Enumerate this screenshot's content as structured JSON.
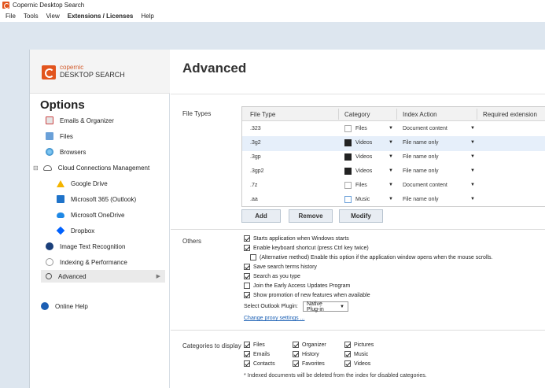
{
  "window": {
    "title": "Copernic Desktop Search"
  },
  "menu": [
    "File",
    "Tools",
    "View",
    "Extensions / Licenses",
    "Help"
  ],
  "logo": {
    "line1": "copernic",
    "line2": "DESKTOP SEARCH"
  },
  "sidebar": {
    "title": "Options",
    "items": [
      {
        "label": "Emails & Organizer",
        "icon": "mail-icon"
      },
      {
        "label": "Files",
        "icon": "files-icon"
      },
      {
        "label": "Browsers",
        "icon": "browser-icon"
      },
      {
        "label": "Cloud Connections Management",
        "icon": "cloud-icon"
      },
      {
        "label": "Google Drive",
        "icon": "google-drive-icon"
      },
      {
        "label": "Microsoft 365 (Outlook)",
        "icon": "microsoft-365-icon"
      },
      {
        "label": "Microsoft OneDrive",
        "icon": "onedrive-icon"
      },
      {
        "label": "Dropbox",
        "icon": "dropbox-icon"
      },
      {
        "label": "Image Text Recognition",
        "icon": "image-text-icon"
      },
      {
        "label": "Indexing & Performance",
        "icon": "indexing-icon"
      },
      {
        "label": "Advanced",
        "icon": "search-icon"
      }
    ],
    "help": "Online Help",
    "collapse_glyph": "⊟",
    "arrow_glyph": "▶"
  },
  "main": {
    "title": "Advanced",
    "file_types": {
      "label": "File Types",
      "columns": [
        "File Type",
        "Category",
        "Index Action",
        "Required extension"
      ],
      "rows": [
        {
          "type": ".323",
          "category": "Files",
          "action": "Document content"
        },
        {
          "type": ".3g2",
          "category": "Videos",
          "action": "File name only"
        },
        {
          "type": ".3gp",
          "category": "Videos",
          "action": "File name only"
        },
        {
          "type": ".3gp2",
          "category": "Videos",
          "action": "File name only"
        },
        {
          "type": ".7z",
          "category": "Files",
          "action": "Document content"
        },
        {
          "type": ".aa",
          "category": "Music",
          "action": "File name only"
        }
      ],
      "buttons": {
        "add": "Add",
        "remove": "Remove",
        "modify": "Modify"
      }
    },
    "others": {
      "label": "Others",
      "options": [
        {
          "label": "Starts application when Windows starts",
          "checked": true
        },
        {
          "label": "Enable keyboard shortcut (press Ctrl key twice)",
          "checked": true
        },
        {
          "label": "(Alternative method) Enable this option if the application window opens when the mouse scrolls.",
          "checked": false
        },
        {
          "label": "Save search terms history",
          "checked": true
        },
        {
          "label": "Search as you type",
          "checked": true
        },
        {
          "label": "Join the Early Access Updates Program",
          "checked": false
        },
        {
          "label": "Show promotion of new features when available",
          "checked": true
        }
      ],
      "outlook_plugin_label": "Select Outlook Plugin:",
      "outlook_plugin_value": "Native Plug-in",
      "proxy_link": "Change proxy settings ..."
    },
    "categories": {
      "label": "Categories to display",
      "items": [
        "Files",
        "Organizer",
        "Pictures",
        "Emails",
        "History",
        "Music",
        "Contacts",
        "Favorites",
        "Videos"
      ],
      "note": "* Indexed documents will be deleted from the index for disabled categories."
    }
  }
}
